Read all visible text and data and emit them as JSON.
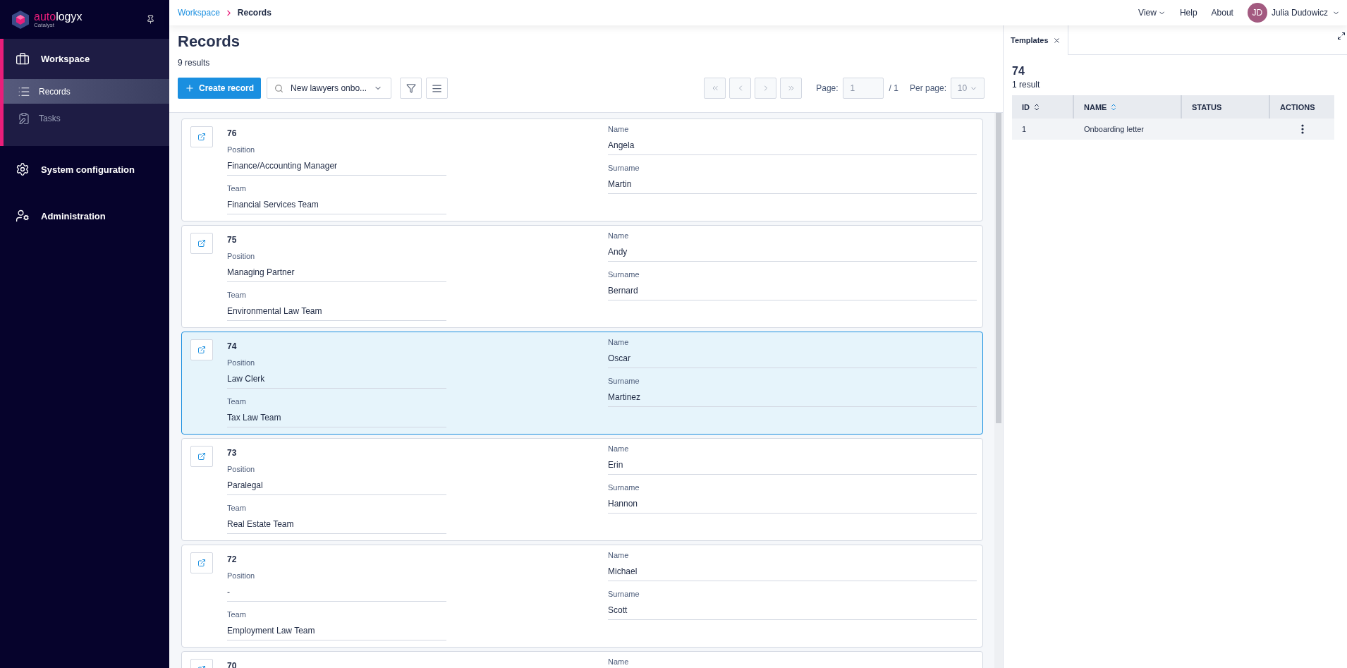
{
  "logo": {
    "brand_highlight": "auto",
    "brand_rest": "logyx",
    "tagline": "Catalyst"
  },
  "nav": [
    {
      "label": "Workspace",
      "expanded": true,
      "children": [
        {
          "label": "Records",
          "selected": true
        },
        {
          "label": "Tasks",
          "selected": false
        }
      ]
    },
    {
      "label": "System configuration",
      "expanded": false
    },
    {
      "label": "Administration",
      "expanded": false
    }
  ],
  "breadcrumb": [
    "Workspace",
    "Records"
  ],
  "top_menu": [
    {
      "label": "View",
      "dropdown": true
    },
    {
      "label": "Help",
      "dropdown": false
    },
    {
      "label": "About",
      "dropdown": false
    }
  ],
  "user": {
    "initials": "JD",
    "name": "Julia Dudowicz"
  },
  "page": {
    "title": "Records",
    "count": "9 results",
    "create_button": "Create record",
    "view_select": "New lawyers onbo..."
  },
  "pagination": {
    "nav_disabled": true,
    "page_label": "Page:",
    "page_value": "1",
    "total": "/ 1",
    "per_page_label": "Per page:",
    "per_page_value": "10"
  },
  "records": [
    {
      "id": "76",
      "selected": false,
      "left": [
        {
          "label": "Position",
          "value": "Finance/Accounting Manager"
        },
        {
          "label": "Team",
          "value": "Financial Services Team"
        }
      ],
      "right": [
        {
          "label": "Name",
          "value": "Angela"
        },
        {
          "label": "Surname",
          "value": "Martin"
        }
      ]
    },
    {
      "id": "75",
      "selected": false,
      "left": [
        {
          "label": "Position",
          "value": "Managing Partner"
        },
        {
          "label": "Team",
          "value": "Environmental Law Team"
        }
      ],
      "right": [
        {
          "label": "Name",
          "value": "Andy"
        },
        {
          "label": "Surname",
          "value": "Bernard"
        }
      ]
    },
    {
      "id": "74",
      "selected": true,
      "left": [
        {
          "label": "Position",
          "value": "Law Clerk"
        },
        {
          "label": "Team",
          "value": "Tax Law Team"
        }
      ],
      "right": [
        {
          "label": "Name",
          "value": "Oscar"
        },
        {
          "label": "Surname",
          "value": "Martinez"
        }
      ]
    },
    {
      "id": "73",
      "selected": false,
      "left": [
        {
          "label": "Position",
          "value": "Paralegal"
        },
        {
          "label": "Team",
          "value": "Real Estate Team"
        }
      ],
      "right": [
        {
          "label": "Name",
          "value": "Erin"
        },
        {
          "label": "Surname",
          "value": "Hannon"
        }
      ]
    },
    {
      "id": "72",
      "selected": false,
      "left": [
        {
          "label": "Position",
          "value": "-"
        },
        {
          "label": "Team",
          "value": "Employment Law Team"
        }
      ],
      "right": [
        {
          "label": "Name",
          "value": "Michael"
        },
        {
          "label": "Surname",
          "value": "Scott"
        }
      ]
    },
    {
      "id": "70",
      "selected": false,
      "right": [
        {
          "label": "Name"
        }
      ]
    }
  ],
  "panel": {
    "tab": {
      "label": "Templates",
      "selected": true
    },
    "title": "74",
    "count": "1 result",
    "columns": [
      {
        "label": "ID",
        "sortable": true
      },
      {
        "label": "NAME",
        "sortable": true
      },
      {
        "label": "STATUS",
        "sortable": false
      },
      {
        "label": "ACTIONS",
        "sortable": false
      }
    ],
    "rows": [
      {
        "id": "1",
        "name": "Onboarding letter"
      }
    ]
  }
}
